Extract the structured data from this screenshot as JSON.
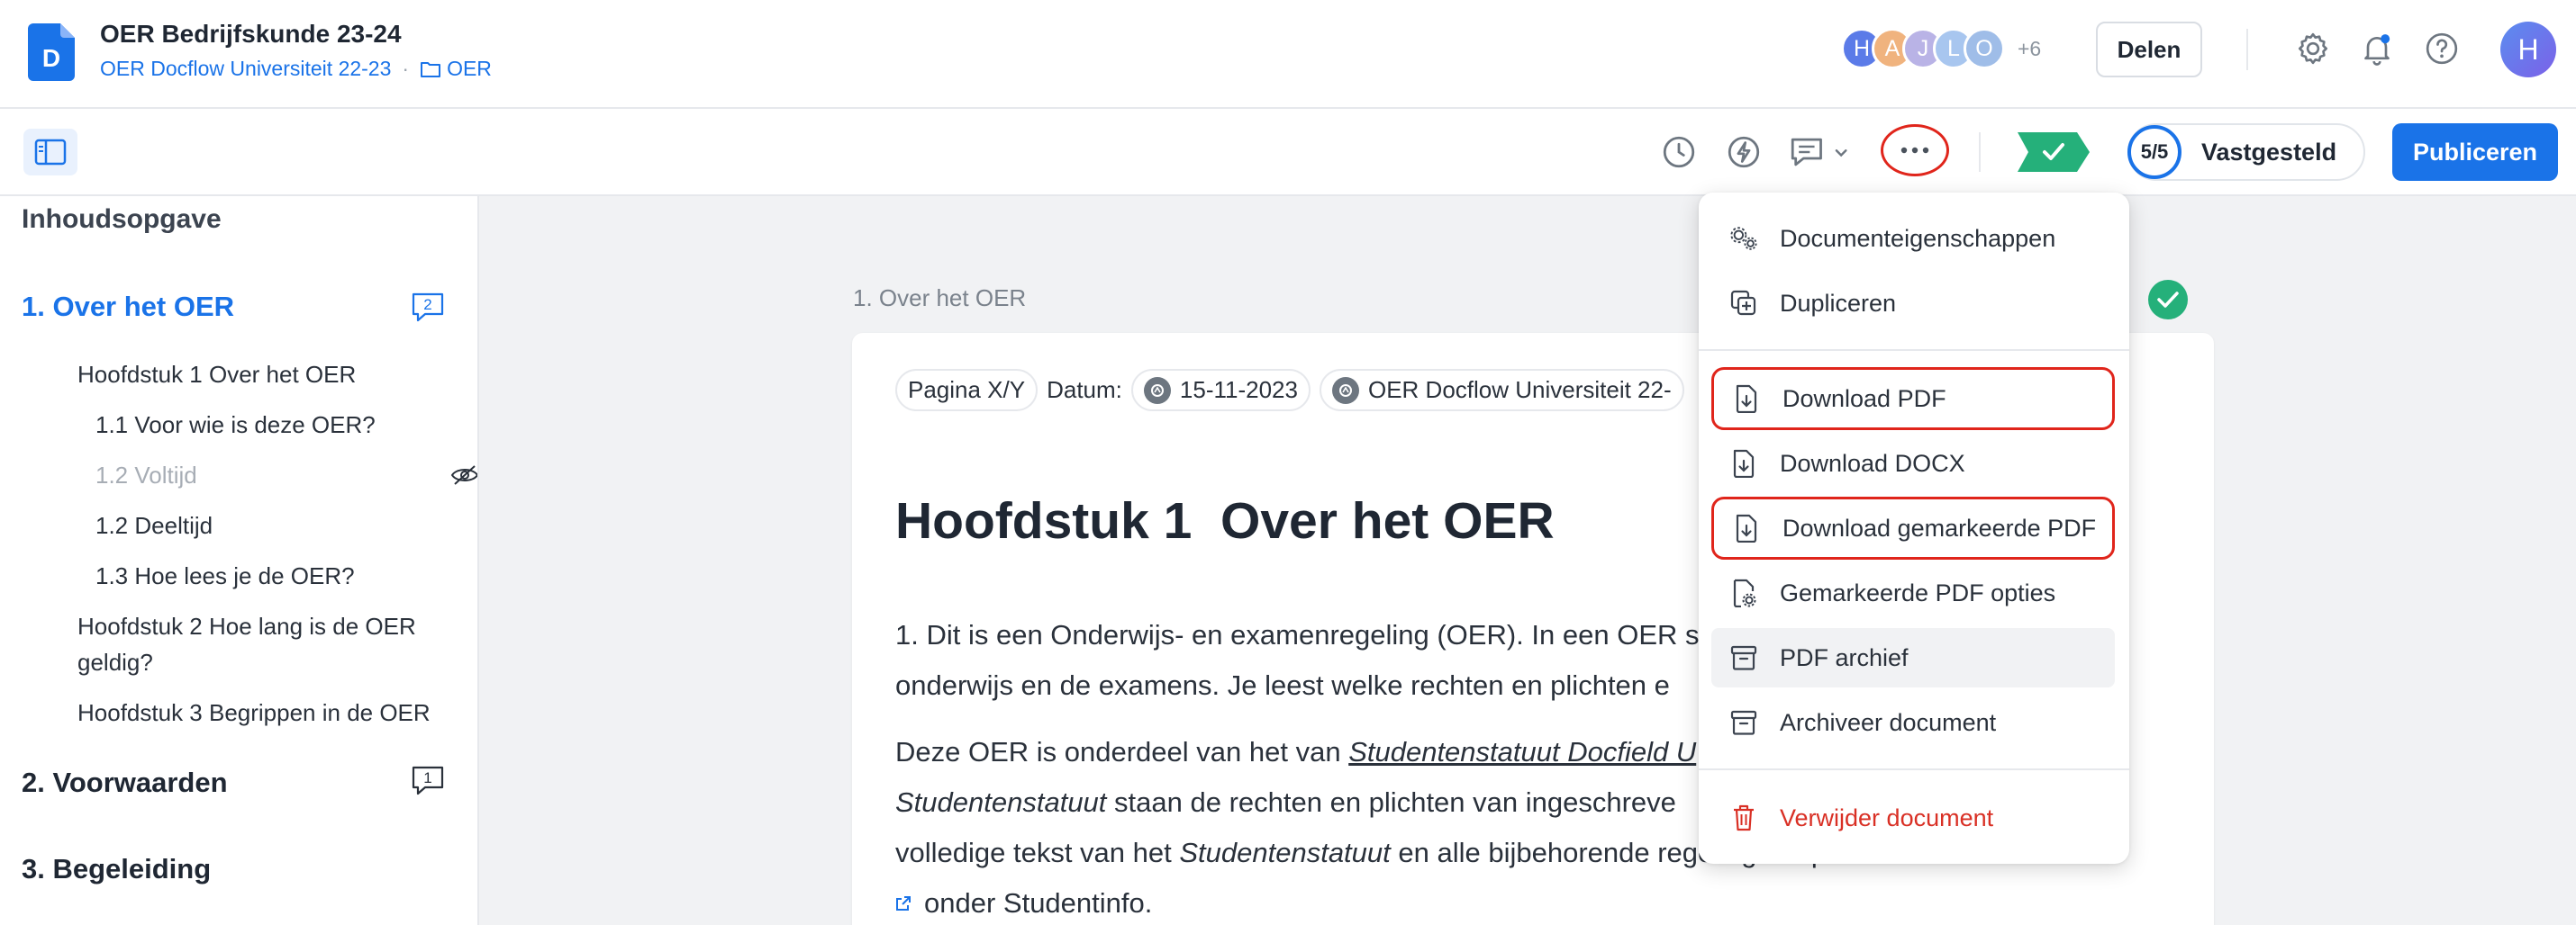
{
  "header": {
    "doc_title": "OER Bedrijfskunde 23-24",
    "breadcrumb_link": "OER Docflow Universiteit 22-23",
    "breadcrumb_sep": "·",
    "folder_label": "OER",
    "avatars": [
      {
        "initial": "H",
        "color": "#5b7be8"
      },
      {
        "initial": "A",
        "color": "#f0b37e"
      },
      {
        "initial": "J",
        "color": "#b9b3e6"
      },
      {
        "initial": "L",
        "color": "#a8c6ef"
      },
      {
        "initial": "O",
        "color": "#9fbde8"
      }
    ],
    "avatars_more": "+6",
    "share_label": "Delen",
    "user_initial": "H"
  },
  "toolbar": {
    "status_count": "5/5",
    "status_label": "Vastgesteld",
    "publish_label": "Publiceren"
  },
  "sidebar": {
    "title": "Inhoudsopgave",
    "sections": [
      {
        "label": "1. Over het OER",
        "comments": "2"
      },
      {
        "label": "2. Voorwaarden",
        "comments": "1"
      },
      {
        "label": "3. Begeleiding"
      }
    ],
    "items": [
      "Hoofdstuk 1 Over het OER",
      "1.1 Voor wie is deze OER?",
      "1.2 Voltijd",
      "1.2 Deeltijd",
      "1.3 Hoe lees je de OER?",
      "Hoofdstuk 2 Hoe lang is de OER",
      "geldig?",
      "Hoofdstuk 3 Begrippen in de OER"
    ]
  },
  "document": {
    "section_label": "1. Over het OER",
    "meta_page": "Pagina X/Y",
    "meta_date_label": "Datum:",
    "meta_date": "15-11-2023",
    "meta_source": "OER Docflow Universiteit 22-",
    "chapter_heading": "Hoofdstuk 1  Over het OER",
    "p1_line1": "1.  Dit is een Onderwijs- en examenregeling (OER). In een OER s",
    "p1_line2": "onderwijs en de examens. Je leest welke rechten en plichten e",
    "p2_line1_a": "Deze OER is onderdeel van het van ",
    "p2_line1_b": "Studentenstatuut Docfield U",
    "p2_line2_a": "Studentenstatuut",
    "p2_line2_b": " staan de rechten en plichten van ingeschreve",
    "p2_line3_a": "volledige tekst van het ",
    "p2_line3_b": "Studentenstatuut",
    "p2_line3_c": " en alle bijbehorende regelingen op www.docfield.com",
    "p2_line4": "onder Studentinfo."
  },
  "menu": {
    "items": [
      {
        "label": "Documenteigenschappen",
        "icon": "settings-gears-icon"
      },
      {
        "label": "Dupliceren",
        "icon": "duplicate-icon"
      },
      {
        "label": "Download PDF",
        "icon": "file-download-icon"
      },
      {
        "label": "Download DOCX",
        "icon": "file-download-icon"
      },
      {
        "label": "Download gemarkeerde PDF",
        "icon": "file-download-icon"
      },
      {
        "label": "Gemarkeerde PDF opties",
        "icon": "file-settings-icon"
      },
      {
        "label": "PDF archief",
        "icon": "archive-icon"
      },
      {
        "label": "Archiveer document",
        "icon": "archive-icon"
      },
      {
        "label": "Verwijder document",
        "icon": "trash-icon"
      }
    ]
  },
  "colors": {
    "accent": "#1a73e8",
    "danger": "#d93025",
    "success": "#25b07a",
    "highlight_ring": "#e0251b"
  }
}
